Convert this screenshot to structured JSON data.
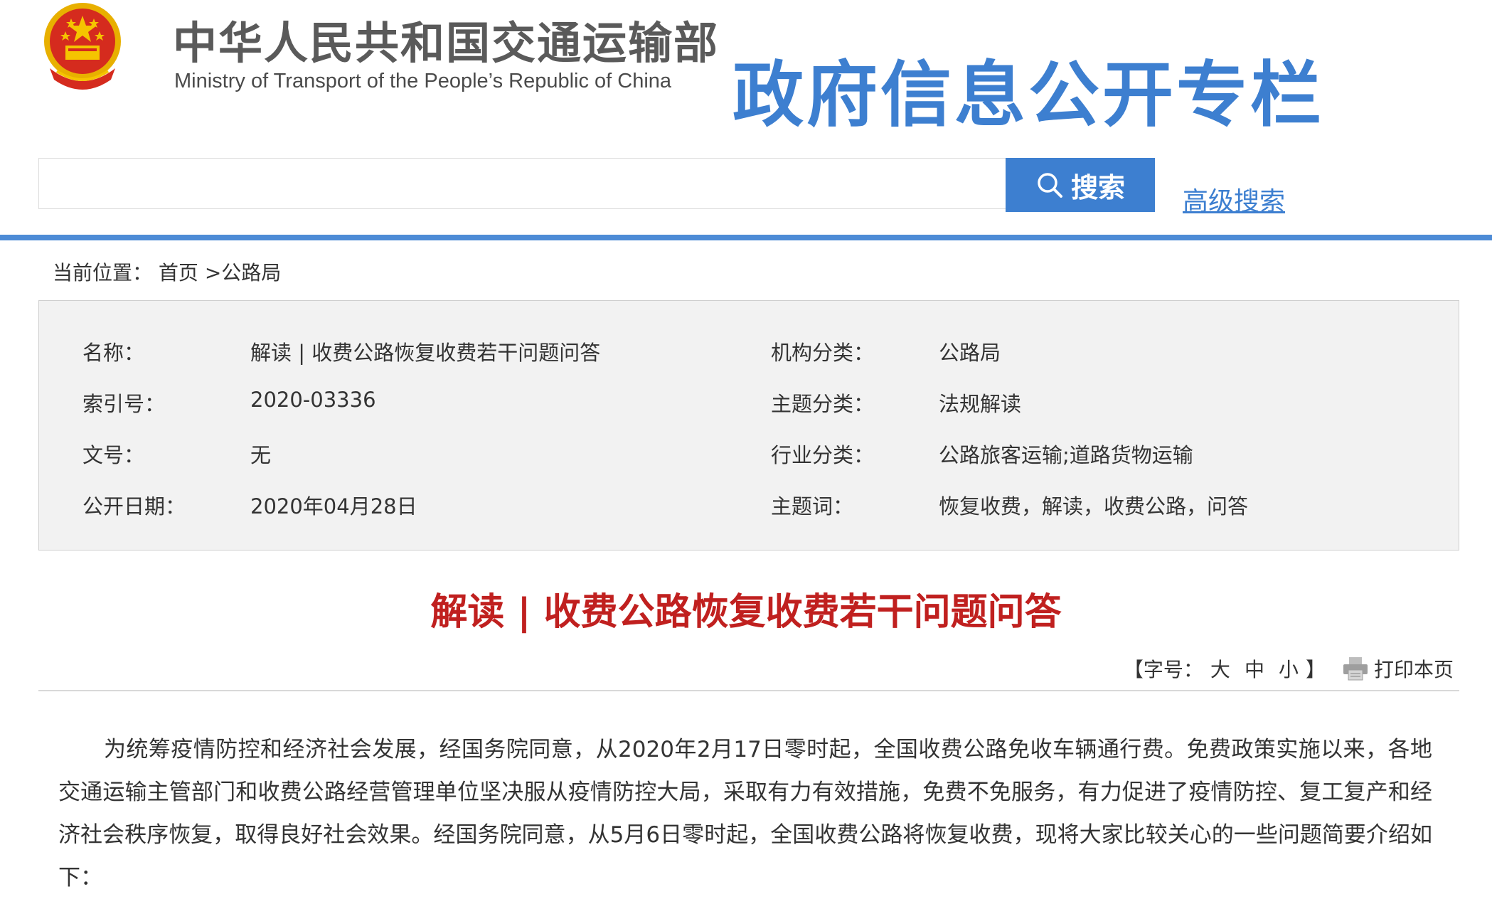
{
  "header": {
    "ministry_cn": "中华人民共和国交通运输部",
    "ministry_en": "Ministry of Transport of the People’s Republic of China",
    "column_title": "政府信息公开专栏",
    "emblem_icon": "national-emblem-icon"
  },
  "search": {
    "value": "",
    "placeholder": "",
    "button_label": "搜索",
    "advanced_label": "高级搜索"
  },
  "breadcrumb": {
    "label": "当前位置：",
    "items": [
      "首页",
      ">公路局"
    ]
  },
  "meta": {
    "left": [
      {
        "label": "名称：",
        "value": "解读 | 收费公路恢复收费若干问题问答"
      },
      {
        "label": "索引号：",
        "value": "2020-03336"
      },
      {
        "label": "文号：",
        "value": "无"
      },
      {
        "label": "公开日期：",
        "value": "2020年04月28日"
      }
    ],
    "right": [
      {
        "label": "机构分类：",
        "value": "公路局"
      },
      {
        "label": "主题分类：",
        "value": "法规解读"
      },
      {
        "label": "行业分类：",
        "value": "公路旅客运输;道路货物运输"
      },
      {
        "label": "主题词：",
        "value": "恢复收费，解读，收费公路，问答"
      }
    ]
  },
  "article": {
    "title": "解读 | 收费公路恢复收费若干问题问答",
    "tools": {
      "open": "【字号：",
      "large": "大",
      "medium": "中",
      "small": "小",
      "close": "】",
      "print_label": "打印本页"
    },
    "paragraph": "为统筹疫情防控和经济社会发展，经国务院同意，从2020年2月17日零时起，全国收费公路免收车辆通行费。免费政策实施以来，各地交通运输主管部门和收费公路经营管理单位坚决服从疫情防控大局，采取有力有效措施，免费不免服务，有力促进了疫情防控、复工复产和经济社会秩序恢复，取得良好社会效果。经国务院同意，从5月6日零时起，全国收费公路将恢复收费，现将大家比较关心的一些问题简要介绍如下："
  },
  "colors": {
    "brand_blue": "#3d7fd0",
    "title_red": "#c0201f",
    "meta_bg": "#f2f2f2"
  }
}
